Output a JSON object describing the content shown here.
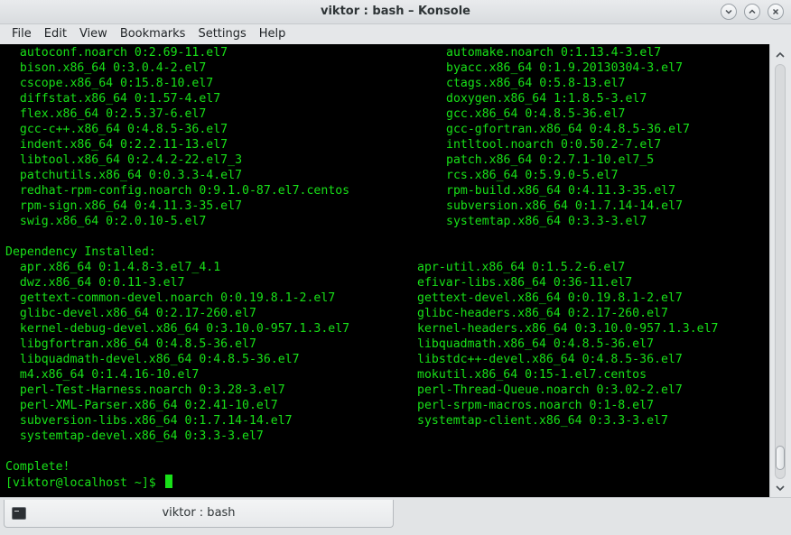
{
  "window": {
    "title": "viktor : bash – Konsole"
  },
  "menubar": {
    "items": [
      "File",
      "Edit",
      "View",
      "Bookmarks",
      "Settings",
      "Help"
    ]
  },
  "terminal": {
    "rows": [
      {
        "left": "  autoconf.noarch 0:2.69-11.el7",
        "right": "automake.noarch 0:1.13.4-3.el7",
        "rcol": 61
      },
      {
        "left": "  bison.x86_64 0:3.0.4-2.el7",
        "right": "byacc.x86_64 0:1.9.20130304-3.el7",
        "rcol": 61
      },
      {
        "left": "  cscope.x86_64 0:15.8-10.el7",
        "right": "ctags.x86_64 0:5.8-13.el7",
        "rcol": 61
      },
      {
        "left": "  diffstat.x86_64 0:1.57-4.el7",
        "right": "doxygen.x86_64 1:1.8.5-3.el7",
        "rcol": 61
      },
      {
        "left": "  flex.x86_64 0:2.5.37-6.el7",
        "right": "gcc.x86_64 0:4.8.5-36.el7",
        "rcol": 61
      },
      {
        "left": "  gcc-c++.x86_64 0:4.8.5-36.el7",
        "right": "gcc-gfortran.x86_64 0:4.8.5-36.el7",
        "rcol": 61
      },
      {
        "left": "  indent.x86_64 0:2.2.11-13.el7",
        "right": "intltool.noarch 0:0.50.2-7.el7",
        "rcol": 61
      },
      {
        "left": "  libtool.x86_64 0:2.4.2-22.el7_3",
        "right": "patch.x86_64 0:2.7.1-10.el7_5",
        "rcol": 61
      },
      {
        "left": "  patchutils.x86_64 0:0.3.3-4.el7",
        "right": "rcs.x86_64 0:5.9.0-5.el7",
        "rcol": 61
      },
      {
        "left": "  redhat-rpm-config.noarch 0:9.1.0-87.el7.centos",
        "right": "rpm-build.x86_64 0:4.11.3-35.el7",
        "rcol": 61
      },
      {
        "left": "  rpm-sign.x86_64 0:4.11.3-35.el7",
        "right": "subversion.x86_64 0:1.7.14-14.el7",
        "rcol": 61
      },
      {
        "left": "  swig.x86_64 0:2.0.10-5.el7",
        "right": "systemtap.x86_64 0:3.3-3.el7",
        "rcol": 61
      },
      {
        "left": "",
        "right": "",
        "rcol": 61
      },
      {
        "left": "Dependency Installed:",
        "right": "",
        "rcol": 57
      },
      {
        "left": "  apr.x86_64 0:1.4.8-3.el7_4.1",
        "right": "apr-util.x86_64 0:1.5.2-6.el7",
        "rcol": 57
      },
      {
        "left": "  dwz.x86_64 0:0.11-3.el7",
        "right": "efivar-libs.x86_64 0:36-11.el7",
        "rcol": 57
      },
      {
        "left": "  gettext-common-devel.noarch 0:0.19.8.1-2.el7",
        "right": "gettext-devel.x86_64 0:0.19.8.1-2.el7",
        "rcol": 57
      },
      {
        "left": "  glibc-devel.x86_64 0:2.17-260.el7",
        "right": "glibc-headers.x86_64 0:2.17-260.el7",
        "rcol": 57
      },
      {
        "left": "  kernel-debug-devel.x86_64 0:3.10.0-957.1.3.el7",
        "right": "kernel-headers.x86_64 0:3.10.0-957.1.3.el7",
        "rcol": 57
      },
      {
        "left": "  libgfortran.x86_64 0:4.8.5-36.el7",
        "right": "libquadmath.x86_64 0:4.8.5-36.el7",
        "rcol": 57
      },
      {
        "left": "  libquadmath-devel.x86_64 0:4.8.5-36.el7",
        "right": "libstdc++-devel.x86_64 0:4.8.5-36.el7",
        "rcol": 57
      },
      {
        "left": "  m4.x86_64 0:1.4.16-10.el7",
        "right": "mokutil.x86_64 0:15-1.el7.centos",
        "rcol": 57
      },
      {
        "left": "  perl-Test-Harness.noarch 0:3.28-3.el7",
        "right": "perl-Thread-Queue.noarch 0:3.02-2.el7",
        "rcol": 57
      },
      {
        "left": "  perl-XML-Parser.x86_64 0:2.41-10.el7",
        "right": "perl-srpm-macros.noarch 0:1-8.el7",
        "rcol": 57
      },
      {
        "left": "  subversion-libs.x86_64 0:1.7.14-14.el7",
        "right": "systemtap-client.x86_64 0:3.3-3.el7",
        "rcol": 57
      },
      {
        "left": "  systemtap-devel.x86_64 0:3.3-3.el7",
        "right": "",
        "rcol": 57
      },
      {
        "left": "",
        "right": "",
        "rcol": 57
      },
      {
        "left": "Complete!",
        "right": "",
        "rcol": 57
      }
    ],
    "prompt": "[viktor@localhost ~]$ "
  },
  "scrollbar": {
    "position_fraction": 0.98,
    "visible_fraction": 0.06
  },
  "tabs": [
    {
      "label": "viktor : bash"
    }
  ],
  "colors": {
    "terminal_bg": "#000000",
    "terminal_fg": "#18e018"
  }
}
